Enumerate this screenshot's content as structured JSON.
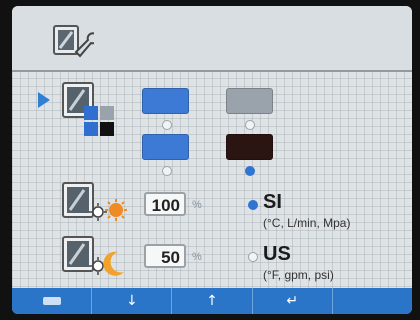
{
  "icons": {
    "header": "display-settings-wrench-icon",
    "selector": "selection-arrow-icon",
    "color_scheme": "color-scheme-monitor-icon",
    "day_brightness": "monitor-day-brightness-icon",
    "night_brightness": "monitor-night-brightness-icon"
  },
  "colors": {
    "accent": "#2f74d0",
    "swatch_blue": "#3d7ad6",
    "swatch_gray": "#9aa3ab",
    "swatch_dark": "#2b1513",
    "footer_bg": "#2b75c9"
  },
  "color_scheme": {
    "selected_index": 3
  },
  "brightness": {
    "day_value": "100",
    "night_value": "50",
    "unit": "%"
  },
  "units": {
    "si_label": "SI",
    "si_detail": "(°C, L/min, Mpa)",
    "us_label": "US",
    "us_detail": "(°F, gpm, psi)",
    "selected": "SI"
  },
  "footer": {
    "buttons": [
      {
        "icon": "back-icon"
      },
      {
        "icon": "arrow-down-icon",
        "glyph": "↓"
      },
      {
        "icon": "arrow-up-icon",
        "glyph": "↑"
      },
      {
        "icon": "enter-icon",
        "glyph": "↵"
      },
      {
        "icon": "blank-icon"
      }
    ]
  }
}
